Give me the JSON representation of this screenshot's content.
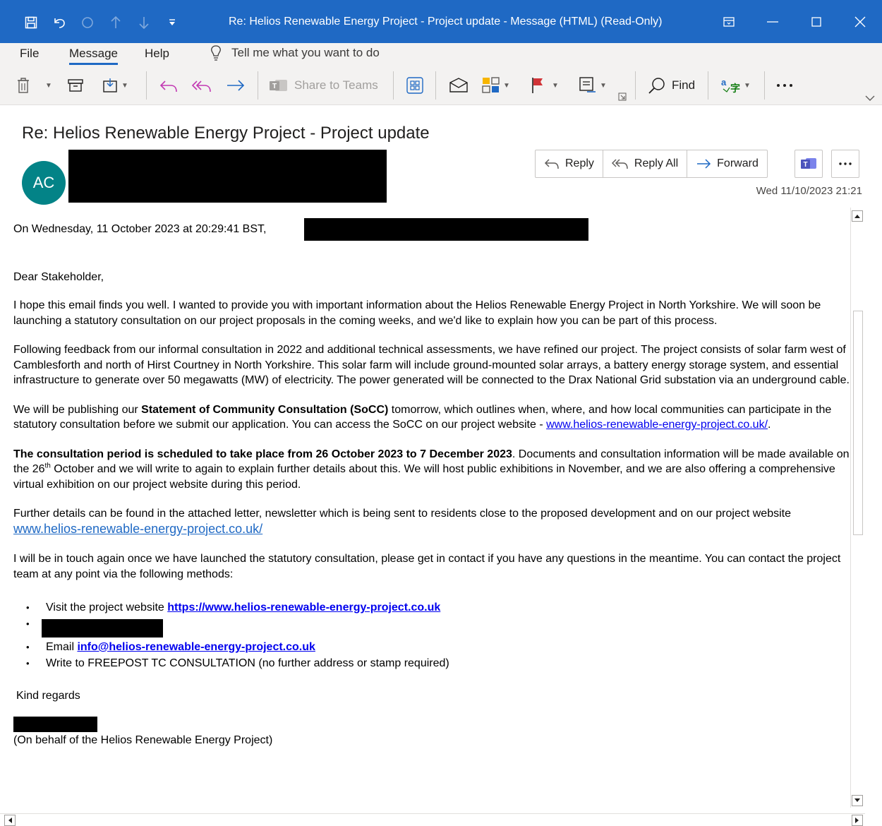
{
  "window": {
    "title": "Re: Helios Renewable Energy Project - Project update  -  Message (HTML) (Read-Only)"
  },
  "menu": {
    "tabs": [
      "File",
      "Message",
      "Help"
    ],
    "tell_me": "Tell me what you want to do"
  },
  "ribbon": {
    "share_to_teams": "Share to Teams",
    "find": "Find"
  },
  "header": {
    "subject": "Re: Helios Renewable Energy Project - Project update",
    "avatar_initials": "AC",
    "reply": "Reply",
    "reply_all": "Reply All",
    "forward": "Forward",
    "datetime": "Wed 11/10/2023 21:21"
  },
  "body": {
    "intro": "On Wednesday, 11 October 2023 at 20:29:41 BST,",
    "greeting": "Dear Stakeholder,",
    "p1": "I hope this email finds you well. I wanted to provide you with important information about the Helios Renewable Energy Project in North Yorkshire. We will soon be launching a statutory consultation on our project proposals in the coming weeks, and we'd like to explain how you can be part of this process.",
    "p2": "Following feedback from our informal consultation in 2022 and additional technical assessments, we have refined our project. The project consists of solar farm west of Camblesforth and north of Hirst Courtney in North Yorkshire. This solar farm will include ground-mounted solar arrays, a battery energy storage system, and essential infrastructure to generate over 50 megawatts (MW) of electricity. The power generated will be connected to the Drax National Grid substation via an underground cable.",
    "p3_a": "We will be publishing our ",
    "p3_bold": "Statement of Community Consultation (SoCC)",
    "p3_b": " tomorrow, which outlines when, where, and how local communities can participate in the statutory consultation before we submit our application. You can access the SoCC on our project website - ",
    "p3_link": "www.helios-renewable-energy-project.co.uk/",
    "p3_c": ".",
    "p4_bold": "The consultation period is scheduled to take place from 26 October 2023 to 7 December 2023",
    "p4_a": ". Documents and consultation information will be made available on the 26",
    "p4_sup": "th",
    "p4_b": " October and we will write to again to explain further details about this. We will host public exhibitions in November, and we are also offering a comprehensive virtual exhibition on our project website during this period.",
    "p5_a": "Further details can be found in the attached letter, newsletter which is being sent to residents close to the proposed development and on our project website ",
    "p5_link": "www.helios-renewable-energy-project.co.uk/",
    "p6": "I will be in touch again once we have launched the statutory consultation, please get in contact if you have any questions in the meantime. You can contact the project team at any point via the following methods:",
    "list": {
      "visit_a": "Visit the project website ",
      "visit_link": "https://www.helios-renewable-energy-project.co.uk",
      "email_a": "Email ",
      "email_link": "info@helios-renewable-energy-project.co.uk",
      "write": "Write to FREEPOST TC CONSULTATION (no further address or stamp required)"
    },
    "regards": "Kind regards",
    "behalf": "(On behalf of the Helios Renewable Energy Project)"
  },
  "colors": {
    "titlebar": "#1f69c4",
    "avatar": "#038387",
    "flag": "#d13438"
  }
}
